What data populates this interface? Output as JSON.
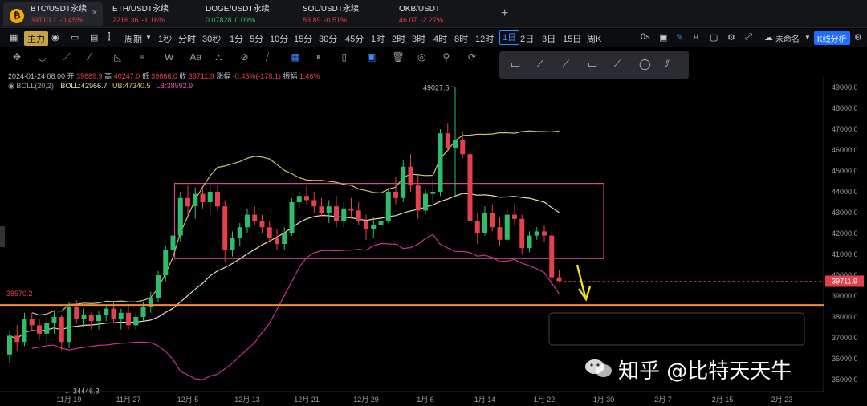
{
  "tabs": [
    {
      "symbol": "BTC/USDT永续",
      "price": "39710.1",
      "change": "-0.45%",
      "price_color": "#e3414b",
      "active": true
    },
    {
      "symbol": "ETH/USDT永续",
      "price": "2216.36",
      "change": "-1.16%",
      "price_color": "#e3414b"
    },
    {
      "symbol": "DOGE/USDT永续",
      "price": "0.07828",
      "change": "0.09%",
      "price_color": "#2ebd6b"
    },
    {
      "symbol": "SOL/USDT永续",
      "price": "83.89",
      "change": "-0.51%",
      "price_color": "#e3414b"
    },
    {
      "symbol": "OKB/USDT",
      "price": "46.07",
      "change": "-2.27%",
      "price_color": "#e3414b"
    }
  ],
  "coin_icon_letter": "₿",
  "add_tab": "+",
  "toolbar": {
    "zhuli": "主力",
    "zhouqi": "周期",
    "intervals": [
      "1秒",
      "分时",
      "30秒",
      "1分",
      "5分",
      "10分",
      "15分",
      "30分",
      "45分",
      "1时",
      "2时",
      "3时",
      "4时",
      "8时",
      "12时",
      "1日",
      "2日",
      "3日",
      "15日",
      "周K"
    ],
    "active_interval": "1日",
    "right_0s": "0s",
    "unnamed": "未命名",
    "k_analysis": "K线分析"
  },
  "drawtools": [
    "✥",
    "◡",
    "⟋",
    "⁄",
    "◺",
    "≡",
    "W",
    "Aa",
    "⛬",
    "⊘",
    "⧸",
    "▦",
    "⏸",
    "▯",
    "▣",
    "🗑",
    "◎",
    "⚲",
    "⟳"
  ],
  "popup_tools": [
    "▭",
    "⟋",
    "⟋",
    "▭",
    "⟋",
    "◯",
    "⫽"
  ],
  "info": {
    "line1_prefix": "2024-01-24 08:00",
    "open_label": "开",
    "open": "39889.9",
    "high_label": "高",
    "high": "40247.0",
    "low_label": "低",
    "low": "39666.0",
    "close_label": "收",
    "close": "39711.9",
    "chg_label": "涨幅",
    "chg": "-0.45%(-178.1)",
    "amp_label": "振幅",
    "amp": "1.46%",
    "boll_label": "BOLL(20,2)",
    "boll": "BOLL:42966.7",
    "ub": "UB:47340.5",
    "lb": "LB:38592.9"
  },
  "colors": {
    "up": "#2ebd6b",
    "down": "#e3414b",
    "mid": "#e6e0b4",
    "ub": "#c9c07a",
    "lb": "#c8348a",
    "box": "#d04b8c",
    "level": "#f08c3c",
    "arrow": "#f2e21a"
  },
  "chart_data": {
    "type": "candlestick",
    "y_ticks": [
      49000,
      48000,
      47000,
      46000,
      45000,
      44000,
      43000,
      42000,
      41000,
      40000,
      39000,
      38000,
      37000,
      36000,
      35000
    ],
    "y_tick_labels": [
      "49000.0",
      "48000.0",
      "47000.0",
      "46000.0",
      "45000.0",
      "44000.0",
      "43000.0",
      "42000.0",
      "41000.0",
      "40000.0",
      "39000.0",
      "38000.0",
      "37000.0",
      "36000.0",
      "35000.0"
    ],
    "x_labels": [
      "11月 19",
      "11月 27",
      "12月 5",
      "12月 13",
      "12月 21",
      "12月 29",
      "1月 6",
      "1月 14",
      "1月 22",
      "1月 30",
      "2月 7",
      "2月 15",
      "2月 23"
    ],
    "x_label_indices": [
      8,
      16,
      24,
      32,
      40,
      48,
      56,
      64,
      72,
      80,
      88,
      96,
      104
    ],
    "current_price": "39711.9",
    "max_label": "49027.5",
    "min_label": "34446.3",
    "level": 38570.2,
    "level_label": "38570.2",
    "range_box": {
      "from_index": 22,
      "to_index": 80,
      "high": 44400,
      "low": 40800
    },
    "candles": [
      [
        36200,
        37300,
        35800,
        37100
      ],
      [
        37100,
        37600,
        36400,
        36800
      ],
      [
        36800,
        38200,
        36600,
        37900
      ],
      [
        37900,
        38200,
        37300,
        37600
      ],
      [
        37600,
        37900,
        36900,
        37200
      ],
      [
        37200,
        38000,
        36700,
        37700
      ],
      [
        37700,
        38300,
        37200,
        38000
      ],
      [
        38000,
        38100,
        36400,
        36800
      ],
      [
        36800,
        38700,
        36500,
        38500
      ],
      [
        38500,
        38800,
        37700,
        37900
      ],
      [
        37900,
        38400,
        37500,
        38100
      ],
      [
        38100,
        38200,
        37400,
        37800
      ],
      [
        37800,
        38300,
        37400,
        38100
      ],
      [
        38100,
        38600,
        37800,
        38400
      ],
      [
        38400,
        38700,
        37700,
        37900
      ],
      [
        37900,
        38400,
        37400,
        38200
      ],
      [
        38200,
        38600,
        37400,
        37600
      ],
      [
        37600,
        38200,
        37400,
        38000
      ],
      [
        38000,
        38700,
        37800,
        38500
      ],
      [
        38500,
        39200,
        38200,
        38900
      ],
      [
        38900,
        40200,
        38700,
        40000
      ],
      [
        40000,
        41400,
        39700,
        41200
      ],
      [
        41200,
        42100,
        40900,
        41900
      ],
      [
        41900,
        44000,
        41600,
        43700
      ],
      [
        43700,
        44300,
        42900,
        43300
      ],
      [
        43300,
        44200,
        42700,
        43900
      ],
      [
        43900,
        44200,
        43200,
        43500
      ],
      [
        43500,
        44300,
        42900,
        44000
      ],
      [
        44000,
        44300,
        43100,
        43300
      ],
      [
        43300,
        43600,
        40600,
        41200
      ],
      [
        41200,
        42100,
        40900,
        41800
      ],
      [
        41800,
        42500,
        41400,
        42300
      ],
      [
        42300,
        43200,
        42000,
        42900
      ],
      [
        42900,
        43300,
        42400,
        42600
      ],
      [
        42600,
        42900,
        42000,
        42300
      ],
      [
        42300,
        42600,
        41600,
        41800
      ],
      [
        41800,
        42200,
        41200,
        41500
      ],
      [
        41500,
        42300,
        41200,
        42000
      ],
      [
        42000,
        43700,
        41900,
        43500
      ],
      [
        43500,
        44000,
        43200,
        43800
      ],
      [
        43800,
        44300,
        43400,
        43600
      ],
      [
        43600,
        44000,
        43000,
        43300
      ],
      [
        43300,
        43700,
        42800,
        43000
      ],
      [
        43000,
        43600,
        42500,
        43300
      ],
      [
        43300,
        43800,
        42300,
        42600
      ],
      [
        42600,
        43500,
        42300,
        43200
      ],
      [
        43200,
        43700,
        42700,
        43100
      ],
      [
        43100,
        43500,
        42400,
        42600
      ],
      [
        42600,
        42900,
        41700,
        42200
      ],
      [
        42200,
        42800,
        41800,
        42400
      ],
      [
        42400,
        42800,
        42000,
        42600
      ],
      [
        42600,
        44200,
        42500,
        44000
      ],
      [
        44000,
        44700,
        43400,
        43700
      ],
      [
        43700,
        45500,
        43500,
        45200
      ],
      [
        45200,
        45800,
        44000,
        44300
      ],
      [
        44300,
        44800,
        42700,
        43100
      ],
      [
        43100,
        44100,
        42900,
        43900
      ],
      [
        43900,
        44600,
        43400,
        44000
      ],
      [
        44000,
        47000,
        43800,
        46800
      ],
      [
        46800,
        47300,
        45900,
        46100
      ],
      [
        46100,
        49027,
        43800,
        46500
      ],
      [
        46500,
        46900,
        45600,
        45800
      ],
      [
        45800,
        46200,
        42000,
        42600
      ],
      [
        42600,
        43000,
        41500,
        42000
      ],
      [
        42000,
        43300,
        41900,
        43000
      ],
      [
        43000,
        43400,
        42100,
        42300
      ],
      [
        42300,
        42800,
        41400,
        41700
      ],
      [
        41700,
        43200,
        41600,
        42900
      ],
      [
        42900,
        43400,
        42400,
        42700
      ],
      [
        42700,
        42900,
        41000,
        41300
      ],
      [
        41300,
        42100,
        41100,
        41900
      ],
      [
        41900,
        42300,
        41700,
        42100
      ],
      [
        42100,
        42400,
        41600,
        41900
      ],
      [
        41900,
        42100,
        39500,
        39900
      ],
      [
        39900,
        40250,
        39666,
        39712
      ]
    ]
  },
  "watermark": "知乎 @比特天天牛"
}
